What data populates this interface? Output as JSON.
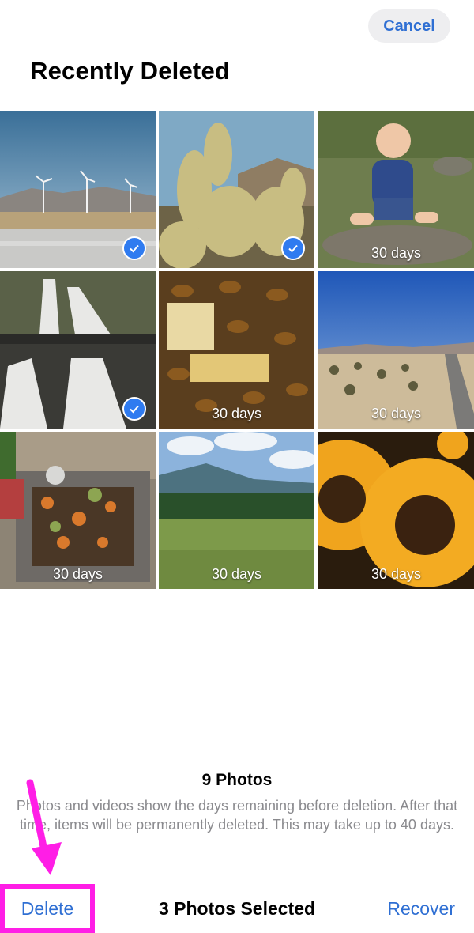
{
  "header": {
    "cancel_label": "Cancel",
    "title": "Recently Deleted"
  },
  "photos": [
    {
      "name": "wind-turbines-photo",
      "selected": true,
      "days": ""
    },
    {
      "name": "cactus-photo",
      "selected": true,
      "days": ""
    },
    {
      "name": "baby-river-photo",
      "selected": false,
      "days": "30 days"
    },
    {
      "name": "waterfall-photo",
      "selected": true,
      "days": ""
    },
    {
      "name": "bees-honeycomb-photo",
      "selected": false,
      "days": "30 days"
    },
    {
      "name": "desert-road-photo",
      "selected": false,
      "days": "30 days"
    },
    {
      "name": "compost-bin-photo",
      "selected": false,
      "days": "30 days"
    },
    {
      "name": "green-valley-photo",
      "selected": false,
      "days": "30 days"
    },
    {
      "name": "sunflowers-photo",
      "selected": false,
      "days": "30 days"
    }
  ],
  "footer": {
    "count": "9 Photos",
    "description": "Photos and videos show the days remaining before deletion. After that time, items will be permanently deleted. This may take up to 40 days."
  },
  "toolbar": {
    "delete_label": "Delete",
    "selected_label": "3 Photos Selected",
    "recover_label": "Recover"
  },
  "colors": {
    "accent": "#2f6fd3",
    "annotation": "#ff1ee6",
    "check": "#2f7bf0"
  }
}
